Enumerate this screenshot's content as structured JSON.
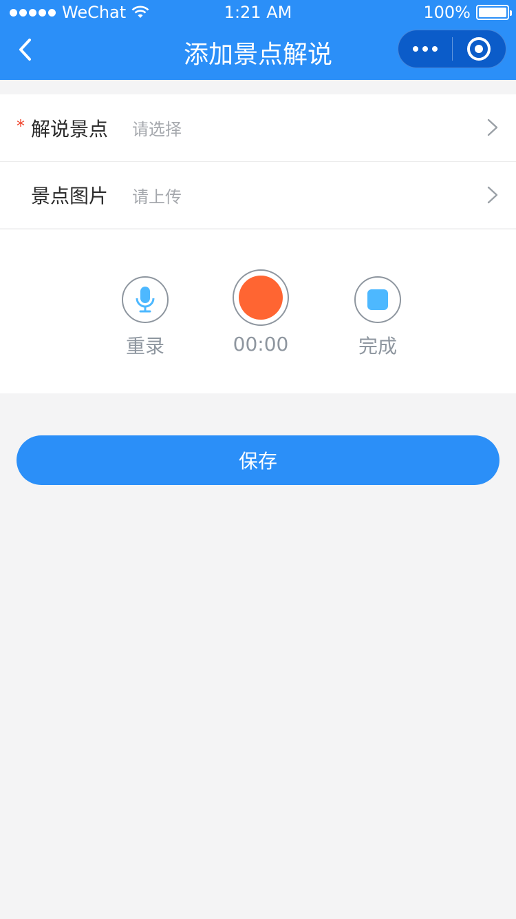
{
  "status_bar": {
    "carrier": "WeChat",
    "time": "1:21 AM",
    "battery": "100%"
  },
  "navbar": {
    "title": "添加景点解说"
  },
  "form": {
    "rows": [
      {
        "required": true,
        "required_mark": "*",
        "label": "解说景点",
        "placeholder": "请选择"
      },
      {
        "required": false,
        "label": "景点图片",
        "placeholder": "请上传"
      }
    ]
  },
  "recorder": {
    "rerecord_label": "重录",
    "timer": "00:00",
    "finish_label": "完成"
  },
  "save_button": {
    "label": "保存"
  },
  "colors": {
    "primary": "#2b8ff8",
    "record": "#ff6532",
    "stop": "#4db8ff",
    "required": "#f0452d"
  }
}
